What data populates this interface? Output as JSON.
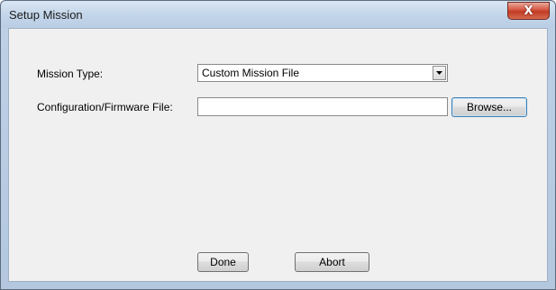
{
  "window": {
    "title": "Setup Mission",
    "close_glyph": "X"
  },
  "form": {
    "mission_type_label": "Mission Type:",
    "mission_type_value": "Custom Mission File",
    "config_file_label": "Configuration/Firmware File:",
    "config_file_value": "",
    "browse_label": "Browse..."
  },
  "footer": {
    "done_label": "Done",
    "abort_label": "Abort"
  },
  "icons": {
    "close": "close-icon",
    "dropdown": "chevron-down-icon"
  },
  "colors": {
    "titlebar": "#c4d6ea",
    "client_background": "#f0f0f0",
    "close_button": "#c9452e",
    "default_button_border": "#3c7fb1"
  }
}
